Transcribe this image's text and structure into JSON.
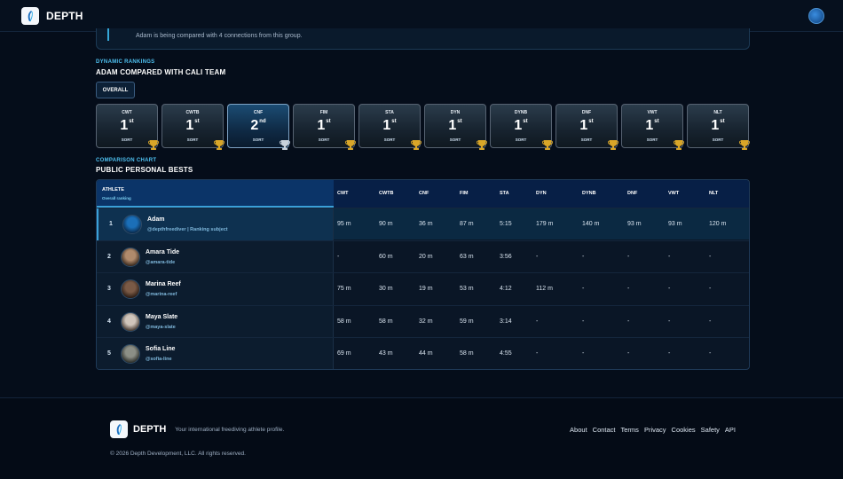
{
  "app": {
    "brand": "DEPTH"
  },
  "notice": {
    "text": "Adam is being compared with 4 connections from this group."
  },
  "rankings": {
    "eyebrow": "DYNAMIC RANKINGS",
    "title": "ADAM COMPARED WITH CALI TEAM",
    "overall_label": "OVERALL",
    "sort_label": "SORT",
    "cards": [
      {
        "label": "CWT",
        "rank": "1",
        "suffix": "st",
        "trophy": "gold-trophy-icon"
      },
      {
        "label": "CWTB",
        "rank": "1",
        "suffix": "st",
        "trophy": "gold-trophy-icon"
      },
      {
        "label": "CNF",
        "rank": "2",
        "suffix": "nd",
        "trophy": "silver-trophy-icon"
      },
      {
        "label": "FIM",
        "rank": "1",
        "suffix": "st",
        "trophy": "gold-trophy-icon"
      },
      {
        "label": "STA",
        "rank": "1",
        "suffix": "st",
        "trophy": "gold-trophy-icon"
      },
      {
        "label": "DYN",
        "rank": "1",
        "suffix": "st",
        "trophy": "gold-trophy-icon"
      },
      {
        "label": "DYNB",
        "rank": "1",
        "suffix": "st",
        "trophy": "gold-trophy-icon"
      },
      {
        "label": "DNF",
        "rank": "1",
        "suffix": "st",
        "trophy": "gold-trophy-icon"
      },
      {
        "label": "VWT",
        "rank": "1",
        "suffix": "st",
        "trophy": "gold-trophy-icon"
      },
      {
        "label": "NLT",
        "rank": "1",
        "suffix": "st",
        "trophy": "gold-trophy-icon"
      }
    ]
  },
  "comparison": {
    "eyebrow": "COMPARISON CHART",
    "title": "PUBLIC PERSONAL BESTS",
    "athlete_header": "ATHLETE",
    "athlete_subheader": "Overall ranking",
    "columns": [
      "CWT",
      "CWTB",
      "CNF",
      "FIM",
      "STA",
      "DYN",
      "DYNB",
      "DNF",
      "VWT",
      "NLT"
    ],
    "rows": [
      {
        "rank": "1",
        "name": "Adam",
        "handle": "@depthfreediver | Ranking subject",
        "values": [
          "95 m",
          "90 m",
          "36 m",
          "87 m",
          "5:15",
          "179 m",
          "140 m",
          "93 m",
          "93 m",
          "120 m"
        ]
      },
      {
        "rank": "2",
        "name": "Amara Tide",
        "handle": "@amara-tide",
        "values": [
          "-",
          "60 m",
          "20 m",
          "63 m",
          "3:56",
          "-",
          "-",
          "-",
          "-",
          "-"
        ]
      },
      {
        "rank": "3",
        "name": "Marina Reef",
        "handle": "@marina-reef",
        "values": [
          "75 m",
          "30 m",
          "19 m",
          "53 m",
          "4:12",
          "112 m",
          "-",
          "-",
          "-",
          "-"
        ]
      },
      {
        "rank": "4",
        "name": "Maya Slate",
        "handle": "@maya-slate",
        "values": [
          "58 m",
          "58 m",
          "32 m",
          "59 m",
          "3:14",
          "-",
          "-",
          "-",
          "-",
          "-"
        ]
      },
      {
        "rank": "5",
        "name": "Sofia Line",
        "handle": "@sofia-line",
        "values": [
          "69 m",
          "43 m",
          "44 m",
          "58 m",
          "4:55",
          "-",
          "-",
          "-",
          "-",
          "-"
        ]
      }
    ]
  },
  "footer": {
    "brand": "DEPTH",
    "tagline": "Your international freediving athlete profile.",
    "links": [
      "About",
      "Contact",
      "Terms",
      "Privacy",
      "Cookies",
      "Safety",
      "API"
    ],
    "copyright": "© 2026 Depth Development, LLC. All rights reserved."
  },
  "colors": {
    "background": "#050d1a",
    "accent": "#4fc2f2",
    "gold": "#d9a628",
    "silver": "#c8d2dc"
  }
}
